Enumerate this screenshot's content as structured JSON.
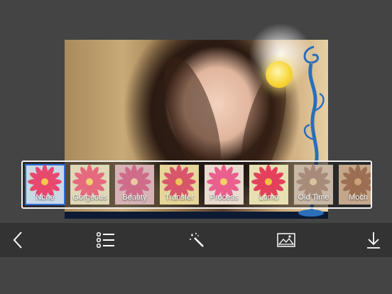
{
  "filters": {
    "items": [
      {
        "label": "None",
        "selected": true,
        "bg": "#c9d8e6",
        "petal": "#e8476e",
        "center": "#f4c84a"
      },
      {
        "label": "Gorgeous",
        "selected": false,
        "bg": "#dfd9b8",
        "petal": "#e56a7e",
        "center": "#f1d070"
      },
      {
        "label": "Beauty",
        "selected": false,
        "bg": "#d7b3b6",
        "petal": "#cf6c89",
        "center": "#ecc8a0"
      },
      {
        "label": "Transfer",
        "selected": false,
        "bg": "#e6d69a",
        "petal": "#d8566c",
        "center": "#f0c15a"
      },
      {
        "label": "Process",
        "selected": false,
        "bg": "#e9dbd0",
        "petal": "#ea5f8d",
        "center": "#f2cf6a"
      },
      {
        "label": "Lomo",
        "selected": false,
        "bg": "#e7e0b2",
        "petal": "#e3405c",
        "center": "#f3c040"
      },
      {
        "label": "Old Time",
        "selected": false,
        "bg": "#c9b8a6",
        "petal": "#a98b79",
        "center": "#d9c4a0"
      },
      {
        "label": "Moch",
        "selected": false,
        "bg": "#c4a78b",
        "petal": "#9c6f52",
        "center": "#c9a276"
      }
    ]
  },
  "toolbar": {
    "icons": [
      "back-chevron-icon",
      "list-icon",
      "magic-wand-icon",
      "image-icon",
      "download-icon"
    ]
  },
  "colors": {
    "background": "#444444",
    "toolbar": "#333333",
    "selection": "#2f6bd6"
  }
}
